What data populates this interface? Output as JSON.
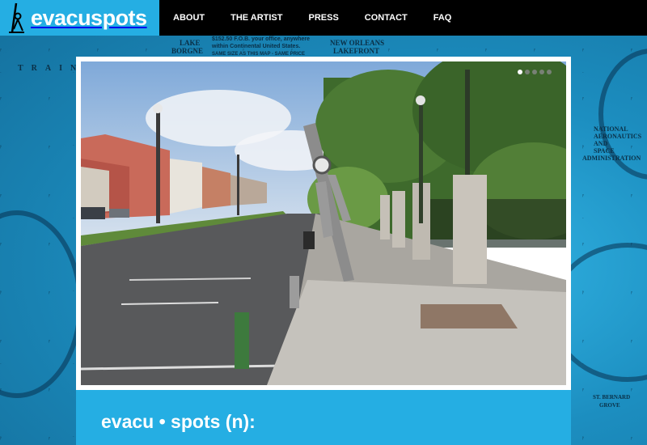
{
  "site": {
    "logo_text": "evacuspots",
    "logo_icon": "stick-figure-icon",
    "brand_color": "#25aee3"
  },
  "nav": {
    "items": [
      {
        "label": "ABOUT"
      },
      {
        "label": "THE ARTIST"
      },
      {
        "label": "PRESS"
      },
      {
        "label": "CONTACT"
      },
      {
        "label": "FAQ"
      }
    ]
  },
  "map_labels": {
    "top_left_strip": "TRAIN",
    "new_orleans": "NEW ORLEANS",
    "lakefront": "LAKEFRONT",
    "lake": "LAKE",
    "borgne": "BORGNE",
    "price_line1": "$152.50 F.O.B. your office, anywhere",
    "price_line2": "within Continental United States.",
    "price_line3": "SAME SIZE AS THIS MAP - SAME PRICE",
    "nasa1": "NATIONAL",
    "nasa2": "AERONAUTICS",
    "nasa3": "AND",
    "nasa4": "SPACE",
    "nasa5": "ADMINISTRATION",
    "stbernard1": "ST. BERNARD",
    "stbernard2": "GROVE"
  },
  "slideshow": {
    "slide_count": 5,
    "active_index": 0
  },
  "definition": {
    "title": "evacu • spots (n):"
  }
}
